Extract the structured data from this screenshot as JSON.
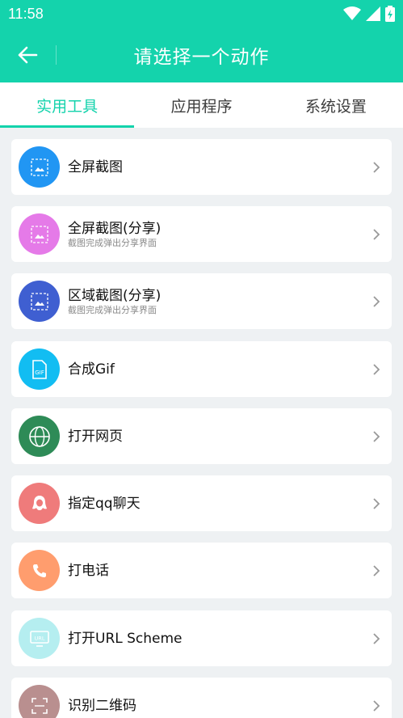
{
  "status": {
    "time": "11:58"
  },
  "appbar": {
    "title": "请选择一个动作"
  },
  "tabs": [
    {
      "label": "实用工具",
      "active": true
    },
    {
      "label": "应用程序",
      "active": false
    },
    {
      "label": "系统设置",
      "active": false
    }
  ],
  "items": [
    {
      "title": "全屏截图",
      "subtitle": "",
      "icon": "screenshot-icon",
      "color": "#2196f3"
    },
    {
      "title": "全屏截图(分享)",
      "subtitle": "截图完成弹出分享界面",
      "icon": "screenshot-share-icon",
      "color": "#e57ae8"
    },
    {
      "title": "区域截图(分享)",
      "subtitle": "截图完成弹出分享界面",
      "icon": "region-screenshot-icon",
      "color": "#3f5fd1"
    },
    {
      "title": "合成Gif",
      "subtitle": "",
      "icon": "gif-icon",
      "color": "#12bdf2"
    },
    {
      "title": "打开网页",
      "subtitle": "",
      "icon": "globe-icon",
      "color": "#2e8b57"
    },
    {
      "title": "指定qq聊天",
      "subtitle": "",
      "icon": "qq-icon",
      "color": "#ef7b7b"
    },
    {
      "title": "打电话",
      "subtitle": "",
      "icon": "phone-icon",
      "color": "#ff9d6e"
    },
    {
      "title": "打开URL Scheme",
      "subtitle": "",
      "icon": "url-icon",
      "color": "#b5eef0"
    },
    {
      "title": "识别二维码",
      "subtitle": "",
      "icon": "qrcode-scan-icon",
      "color": "#b98f8f"
    }
  ]
}
